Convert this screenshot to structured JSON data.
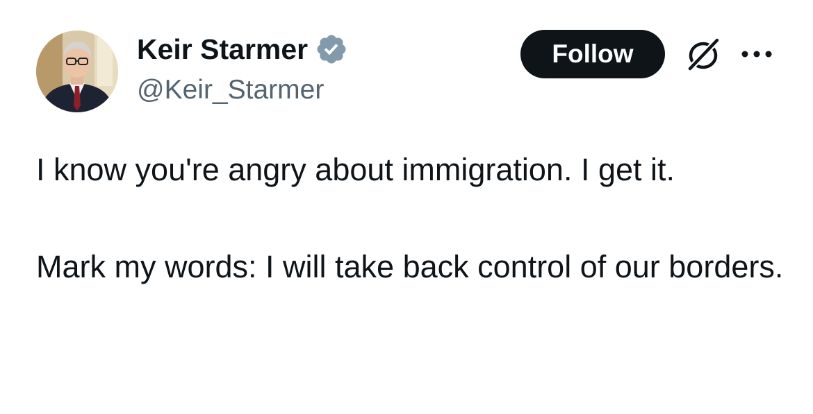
{
  "author": {
    "display_name": "Keir Starmer",
    "handle": "@Keir_Starmer",
    "verified_color": "#829aab"
  },
  "actions": {
    "follow_label": "Follow",
    "grok_icon": "grok-icon",
    "more_icon": "more-icon"
  },
  "tweet": {
    "paragraphs": [
      "I know you're angry about immigration. I get it.",
      "Mark my words: I will take back control of our borders."
    ]
  },
  "colors": {
    "text_primary": "#0f1419",
    "text_secondary": "#536471",
    "button_bg": "#0f1419",
    "button_text": "#ffffff"
  }
}
